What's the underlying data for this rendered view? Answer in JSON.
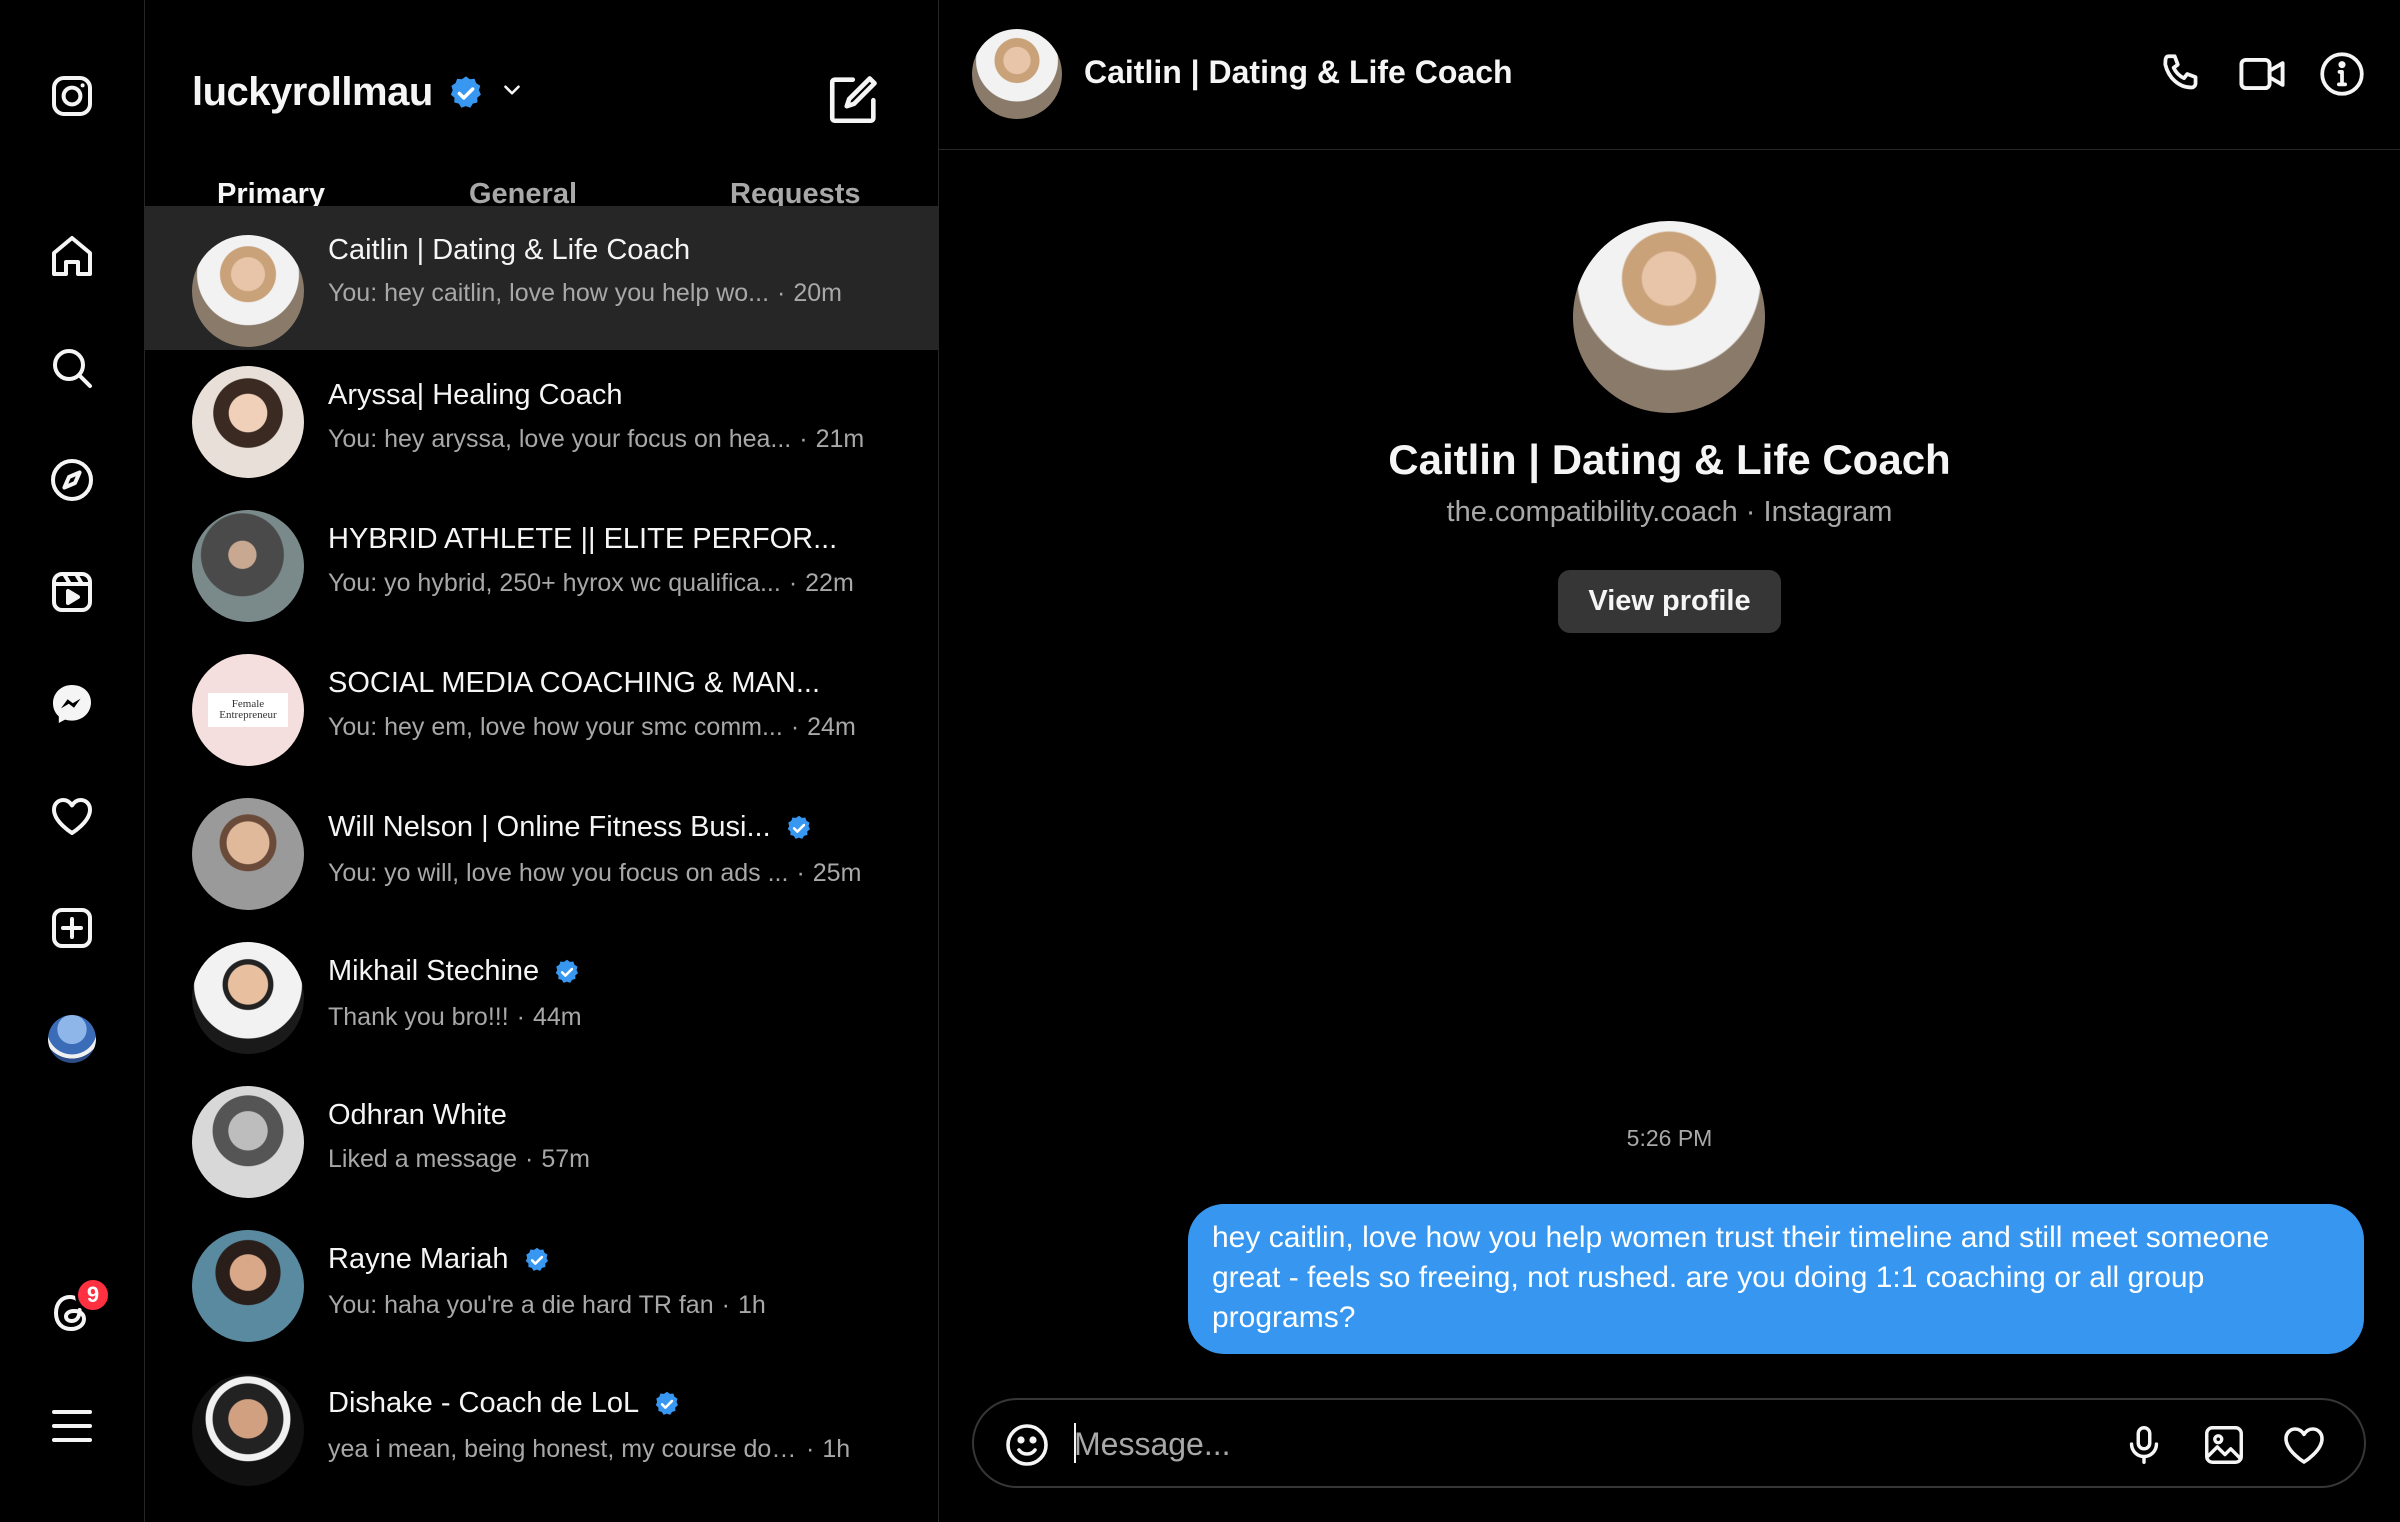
{
  "rail": {
    "icons": [
      "instagram-logo",
      "home-icon",
      "search-icon",
      "explore-icon",
      "reels-icon",
      "messenger-icon",
      "heart-icon",
      "create-icon",
      "profile-avatar",
      "threads-icon",
      "menu-icon"
    ],
    "threads_badge": "9"
  },
  "inbox": {
    "account": "luckyrollmau",
    "tabs": [
      "Primary",
      "General",
      "Requests"
    ],
    "conversations": [
      {
        "name": "Caitlin | Dating & Life Coach",
        "preview": "You: hey caitlin, love how you help wo...",
        "time": "20m",
        "verified": false
      },
      {
        "name": "Aryssa| Healing Coach",
        "preview": "You: hey aryssa, love your focus on hea...",
        "time": "21m",
        "verified": false
      },
      {
        "name": "HYBRID ATHLETE || ELITE PERFOR...",
        "preview": "You: yo hybrid, 250+ hyrox wc qualifica...",
        "time": "22m",
        "verified": false
      },
      {
        "name": "SOCIAL MEDIA COACHING & MAN...",
        "preview": "You: hey em, love how your smc comm...",
        "time": "24m",
        "verified": false
      },
      {
        "name": "Will Nelson | Online Fitness Busi...",
        "preview": "You: yo will, love how you focus on ads ...",
        "time": "25m",
        "verified": true
      },
      {
        "name": "Mikhail Stechine",
        "preview": "Thank you bro!!!",
        "time": "44m",
        "verified": true
      },
      {
        "name": "Odhran White",
        "preview": "Liked a message",
        "time": "57m",
        "verified": false
      },
      {
        "name": "Rayne Mariah",
        "preview": "You: haha you're a die hard TR fan",
        "time": "1h",
        "verified": true
      },
      {
        "name": "Dishake - Coach de LoL",
        "preview": "yea i mean, being honest, my course doe...",
        "time": "1h",
        "verified": true
      }
    ]
  },
  "chat": {
    "header_name": "Caitlin | Dating & Life Coach",
    "profile_name": "Caitlin | Dating & Life Coach",
    "profile_sub": "the.compatibility.coach · Instagram",
    "view_profile_label": "View profile",
    "timestamp": "5:26 PM",
    "messages": [
      {
        "from": "me",
        "text": "hey caitlin, love how you help women trust their timeline and still meet someone great - feels so freeing, not rushed. are you doing 1:1 coaching or all group programs?"
      }
    ],
    "composer_placeholder": "Message..."
  },
  "colors": {
    "background": "#000000",
    "selected_row": "#262626",
    "bubble": "#3797f0",
    "verified": "#3897f0",
    "badge": "#ff3040"
  }
}
